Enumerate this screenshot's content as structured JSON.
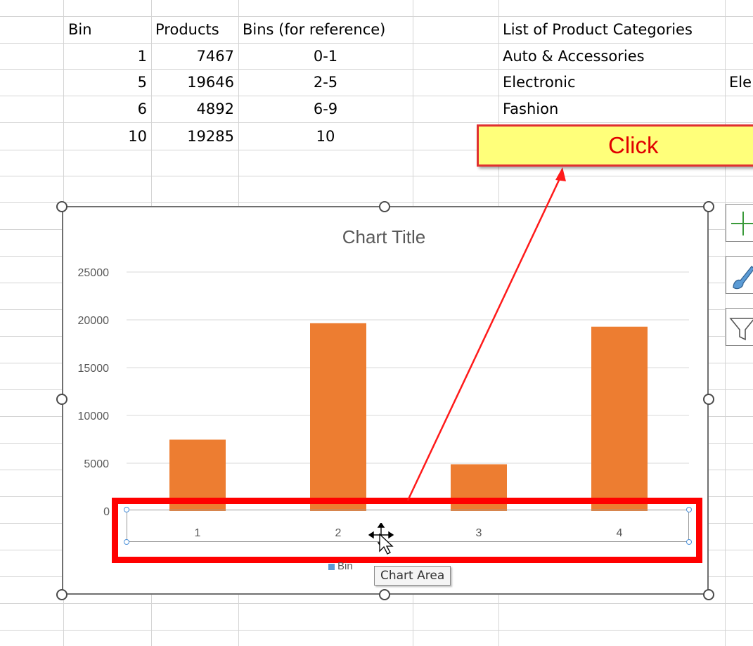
{
  "sheet": {
    "headers": {
      "bin": "Bin",
      "products": "Products",
      "bins_ref": "Bins (for reference)",
      "categories": "List of Product Categories"
    },
    "rows": [
      {
        "bin": "1",
        "products": "7467",
        "ref": "0-1",
        "category": "Auto & Accessories",
        "extra": ""
      },
      {
        "bin": "5",
        "products": "19646",
        "ref": "2-5",
        "category": "Electronic",
        "extra": "Ele"
      },
      {
        "bin": "6",
        "products": "4892",
        "ref": "6-9",
        "category": "Fashion",
        "extra": ""
      },
      {
        "bin": "10",
        "products": "19285",
        "ref": "10",
        "category": "",
        "extra": ""
      }
    ]
  },
  "callout": {
    "text": "Click",
    "color": "#e00000",
    "background": "#ffff7a"
  },
  "chart": {
    "legend_label": "Bin",
    "tooltip": "Chart Area",
    "bar_color": "#ed7d31",
    "legend_color": "#5b9bd5",
    "highlight_color": "#ff0000",
    "side_buttons": [
      "add-chart-element",
      "chart-styles",
      "chart-filters"
    ]
  },
  "chart_data": {
    "type": "bar",
    "title": "Chart Title",
    "categories": [
      "1",
      "2",
      "3",
      "4"
    ],
    "series": [
      {
        "name": "Bin",
        "values": [
          7467,
          19646,
          4892,
          19285
        ]
      }
    ],
    "ylim": [
      0,
      25000
    ],
    "yticks": [
      "0",
      "5000",
      "10000",
      "15000",
      "20000",
      "25000"
    ],
    "grid": true,
    "legend": "bottom"
  }
}
